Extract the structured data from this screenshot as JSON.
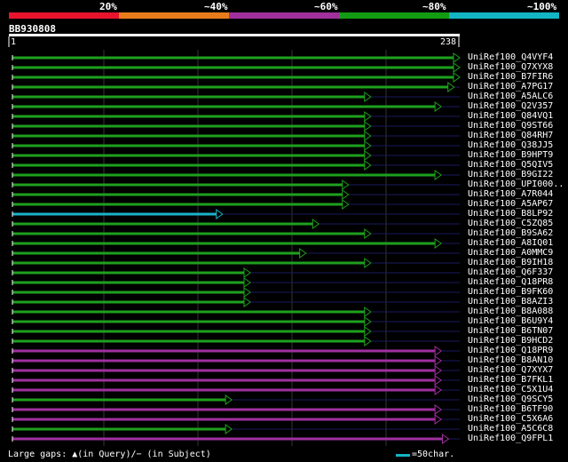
{
  "ruler": {
    "percent_labels": [
      "20%",
      "~40%",
      "~60%",
      "~80%",
      "~100%"
    ],
    "colors": [
      "#e8142e",
      "#e87c1c",
      "#a0309c",
      "#139c13",
      "#13b4c4"
    ]
  },
  "query": {
    "id": "BB930808",
    "start": "1",
    "end": "238"
  },
  "hits": [
    {
      "id": "UniRef100_Q4VYF4",
      "color": "green",
      "end": 238
    },
    {
      "id": "UniRef100_Q7XYX8",
      "color": "green",
      "end": 238
    },
    {
      "id": "UniRef100_B7FIR6",
      "color": "green",
      "end": 238
    },
    {
      "id": "UniRef100_A7PG17",
      "color": "green",
      "end": 235
    },
    {
      "id": "UniRef100_A5ALC6",
      "color": "green",
      "end": 190
    },
    {
      "id": "UniRef100_Q2V357",
      "color": "green",
      "end": 228
    },
    {
      "id": "UniRef100_Q84VQ1",
      "color": "green",
      "end": 190
    },
    {
      "id": "UniRef100_Q9ST66",
      "color": "green",
      "end": 190
    },
    {
      "id": "UniRef100_Q84RH7",
      "color": "green",
      "end": 190
    },
    {
      "id": "UniRef100_Q38JJ5",
      "color": "green",
      "end": 190
    },
    {
      "id": "UniRef100_B9HPT9",
      "color": "green",
      "end": 190
    },
    {
      "id": "UniRef100_Q5QIV5",
      "color": "green",
      "end": 190
    },
    {
      "id": "UniRef100_B9GI22",
      "color": "green",
      "end": 228
    },
    {
      "id": "UniRef100_UPI000..",
      "color": "green",
      "end": 178
    },
    {
      "id": "UniRef100_A7R044",
      "color": "green",
      "end": 178
    },
    {
      "id": "UniRef100_A5AP67",
      "color": "green",
      "end": 178
    },
    {
      "id": "UniRef100_B8LP92",
      "color": "cyan",
      "end": 110
    },
    {
      "id": "UniRef100_C5ZQ85",
      "color": "green",
      "end": 162
    },
    {
      "id": "UniRef100_B9SA62",
      "color": "green",
      "end": 190
    },
    {
      "id": "UniRef100_A8IQ01",
      "color": "green",
      "end": 228
    },
    {
      "id": "UniRef100_A0MMC9",
      "color": "green",
      "end": 155
    },
    {
      "id": "UniRef100_B9IH18",
      "color": "green",
      "end": 190
    },
    {
      "id": "UniRef100_Q6F337",
      "color": "green",
      "end": 125
    },
    {
      "id": "UniRef100_Q18PR8",
      "color": "green",
      "end": 125
    },
    {
      "id": "UniRef100_B9FK60",
      "color": "green",
      "end": 125
    },
    {
      "id": "UniRef100_B8AZI3",
      "color": "green",
      "end": 125
    },
    {
      "id": "UniRef100_B8A088",
      "color": "green",
      "end": 190
    },
    {
      "id": "UniRef100_B6U9Y4",
      "color": "green",
      "end": 190
    },
    {
      "id": "UniRef100_B6TN07",
      "color": "green",
      "end": 190
    },
    {
      "id": "UniRef100_B9HCD2",
      "color": "green",
      "end": 190
    },
    {
      "id": "UniRef100_Q18PR9",
      "color": "purple",
      "end": 228
    },
    {
      "id": "UniRef100_B8AN10",
      "color": "purple",
      "end": 228
    },
    {
      "id": "UniRef100_Q7XYX7",
      "color": "purple",
      "end": 228
    },
    {
      "id": "UniRef100_B7FKL1",
      "color": "purple",
      "end": 228
    },
    {
      "id": "UniRef100_C5X1U4",
      "color": "purple",
      "end": 228
    },
    {
      "id": "UniRef100_Q9SCY5",
      "color": "green",
      "end": 115
    },
    {
      "id": "UniRef100_B6TF90",
      "color": "purple",
      "end": 228
    },
    {
      "id": "UniRef100_C5X6A6",
      "color": "purple",
      "end": 228
    },
    {
      "id": "UniRef100_A5C6C8",
      "color": "green",
      "end": 115
    },
    {
      "id": "UniRef100_Q9FPL1",
      "color": "purple",
      "end": 232
    }
  ],
  "legend": {
    "text": "Large gaps: ▲(in Query)/− (in Subject)",
    "scale": "=50char."
  }
}
